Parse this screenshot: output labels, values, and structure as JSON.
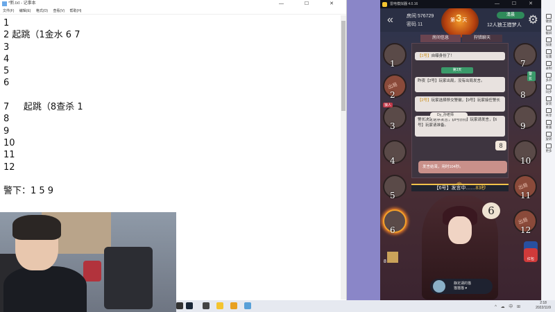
{
  "notepad": {
    "title": "*新.txt - 记事本",
    "window_buttons": "— ☐ ✕",
    "menu": [
      "文件(F)",
      "编辑(E)",
      "格式(O)",
      "查看(V)",
      "帮助(H)"
    ],
    "lines": [
      "1",
      "2 起跳（1金水 6 7",
      "3",
      "4",
      "5",
      "6",
      "",
      "7     起跳（8查杀 1",
      "8",
      "9",
      "10",
      "11",
      "12",
      "",
      "警下：1 5 9"
    ]
  },
  "emulator": {
    "title": "雷电模拟器 4.0.16",
    "window_buttons": "— ☐ ✕"
  },
  "game": {
    "back_glyph": "«",
    "room_id": "房间 576729",
    "password": "密码 11",
    "day_prefix": "第",
    "day_number": "3",
    "day_suffix": "天",
    "mode_badge": "清晨",
    "mode_text": "12人狼王猎梦人",
    "tabs": [
      "房间信息",
      "狩猎聊天"
    ],
    "messages": [
      {
        "pre": "【1号】",
        "text": "自曝身份了！"
      },
      {
        "pre": "",
        "text": "昨夜【2号】玩家出局，没有出局发言。"
      },
      {
        "pre": "【2号】",
        "text": "玩家选择移交警徽，【9号】玩家接任警长"
      },
      {
        "pre": "",
        "text": "警长决定逆序发言，【8号(你)】玩家请发言，【6号】玩家请准备。"
      }
    ],
    "day_bar": "第3天",
    "speaker_name": "Dy_孙老师",
    "speaker_number": "8",
    "speech_end": "发言结束，用时104秒。",
    "speaking_prefix": "【6号】发言中……",
    "speaking_seconds": "83秒",
    "bubble_number": "6",
    "seats_left": [
      {
        "n": "1",
        "out": false
      },
      {
        "n": "2",
        "out": true
      },
      {
        "n": "3",
        "out": false,
        "tag": "狼人"
      },
      {
        "n": "4",
        "out": false
      },
      {
        "n": "5",
        "out": false
      },
      {
        "n": "6",
        "out": false,
        "speaking": true
      }
    ],
    "seats_right": [
      {
        "n": "7",
        "out": false
      },
      {
        "n": "8",
        "out": false,
        "tag": "警长"
      },
      {
        "n": "9",
        "out": false
      },
      {
        "n": "10",
        "out": false
      },
      {
        "n": "11",
        "out": true
      },
      {
        "n": "12",
        "out": true
      }
    ],
    "out_label": "出局",
    "watching_name": "静定湖的猫",
    "watching_sub": "猫猫猫 ♥",
    "spectators": "8",
    "btn_police": "警长",
    "btn_gift": "红包"
  },
  "strip": [
    "键盘",
    "截屏",
    "加速",
    "设置",
    "录制",
    "多开",
    "同步",
    "安装",
    "共享",
    "重置",
    "旋转",
    "更多"
  ],
  "taskbar": {
    "time": "2:18",
    "date": "2022/11/9",
    "tray": "^ ☁ 中 ⊞"
  }
}
